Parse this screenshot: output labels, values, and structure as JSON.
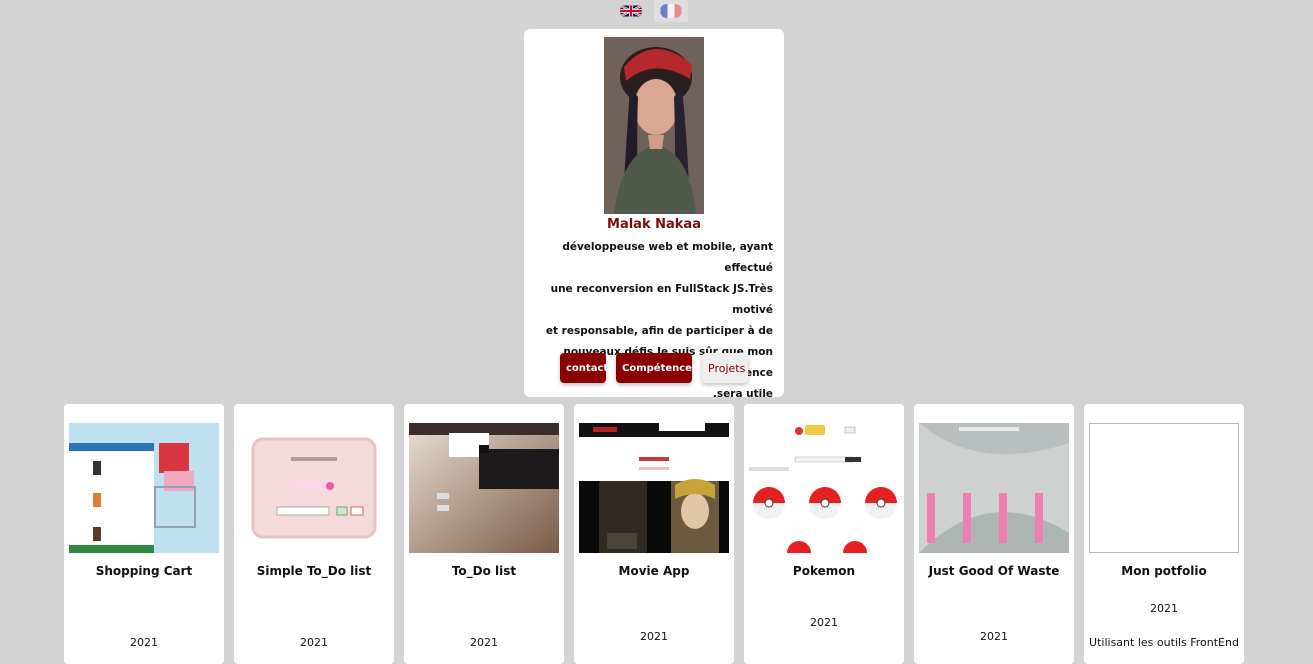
{
  "languages": [
    {
      "code": "en",
      "flag": "uk-flag-icon"
    },
    {
      "code": "fr",
      "flag": "fr-flag-icon"
    }
  ],
  "profile": {
    "name": "Malak Nakaa",
    "bio_lines": [
      "développeuse web et mobile, ayant effectué",
      "une reconversion en FullStack JS.Très motivé",
      "et responsable, afin de participer à de",
      "nouveaux défis,Je suis sûr que mon expérience",
      ".sera utile"
    ],
    "buttons": {
      "contact": "contact",
      "skills": "Compétences",
      "projects": "Projets"
    }
  },
  "projects": [
    {
      "title": "Shopping Cart",
      "year": "2021",
      "thumb": "shopping-cart-screenshot"
    },
    {
      "title": "Simple To_Do list",
      "year": "2021",
      "thumb": "simple-todo-screenshot"
    },
    {
      "title": "To_Do list",
      "year": "2021",
      "thumb": "todo-screenshot"
    },
    {
      "title": "Movie App",
      "year": "2021",
      "thumb": "movie-app-screenshot"
    },
    {
      "title": "Pokemon",
      "year": "2021",
      "thumb": "pokemon-screenshot"
    },
    {
      "title": "Just Good Of Waste",
      "year": "2021",
      "thumb": "just-good-of-waste-screenshot"
    },
    {
      "title": "Mon potfolio",
      "year": "2021",
      "thumb": "portfolio-blank-thumbnail",
      "description": "Utilisant les outils FrontEnd"
    }
  ],
  "colors": {
    "background": "#d3d3d3",
    "accent": "#8b0000",
    "name": "#7a0d0d"
  }
}
